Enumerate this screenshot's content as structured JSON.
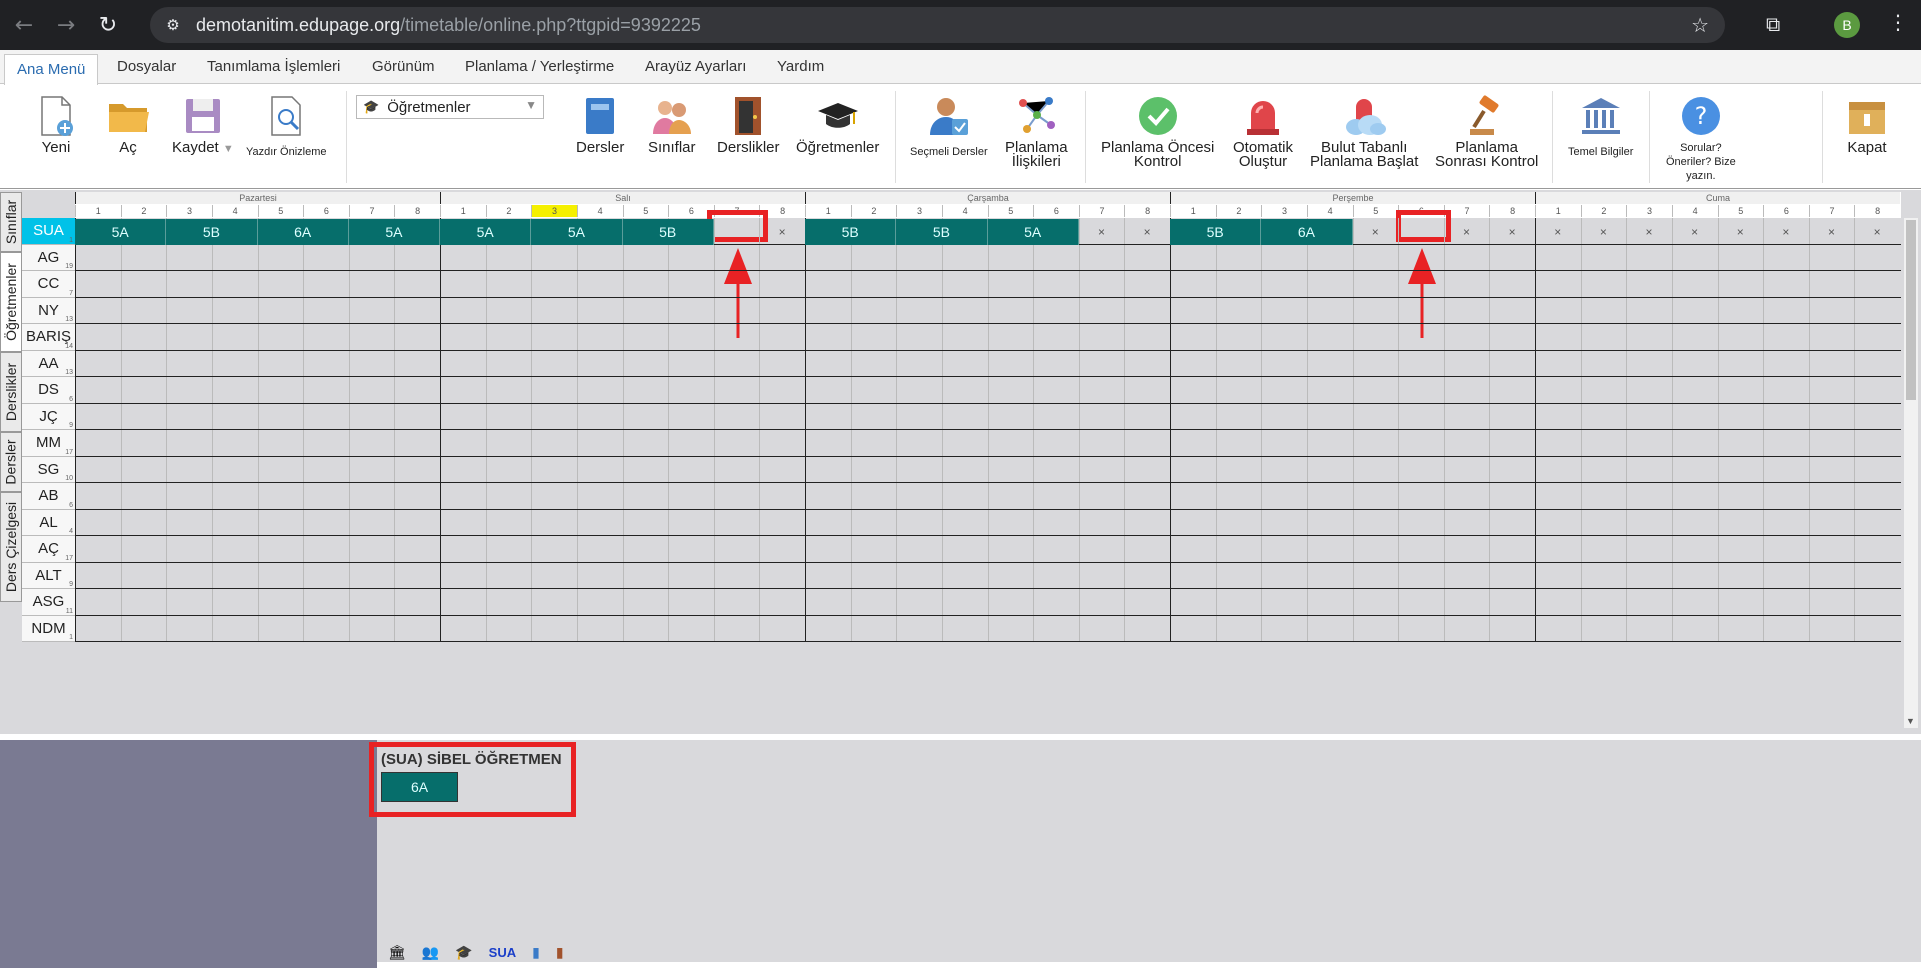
{
  "browser": {
    "url_host": "demotanitim.edupage.org",
    "url_path": "/timetable/online.php?ttgpid=9392225",
    "avatar_letter": "B"
  },
  "menu": [
    "Ana Menü",
    "Dosyalar",
    "Tanımlama İşlemleri",
    "Görünüm",
    "Planlama / Yerleştirme",
    "Arayüz Ayarları",
    "Yardım"
  ],
  "toolbar": {
    "new": "Yeni",
    "open": "Aç",
    "save": "Kaydet",
    "print_preview": "Yazdır Önizleme",
    "view_select": "Öğretmenler",
    "subjects": "Dersler",
    "classes": "Sınıflar",
    "classrooms": "Derslikler",
    "teachers": "Öğretmenler",
    "elective_1": "Seçmeli Dersler",
    "relations_1": "Planlama",
    "relations_2": "İlişkileri",
    "precheck_1": "Planlama Öncesi",
    "precheck_2": "Kontrol",
    "auto_1": "Otomatik",
    "auto_2": "Oluştur",
    "cloud_1": "Bulut Tabanlı",
    "cloud_2": "Planlama Başlat",
    "postcheck_1": "Planlama",
    "postcheck_2": "Sonrası Kontrol",
    "basic_info": "Temel Bilgiler",
    "feedback_1": "Sorular?",
    "feedback_2": "Öneriler? Bize",
    "feedback_3": "yazın.",
    "close": "Kapat"
  },
  "side_tabs": [
    "Sınıflar",
    "Öğretmenler",
    "Derslikler",
    "Dersler",
    "Ders Çizelgesi"
  ],
  "days": [
    "Pazartesi",
    "Salı",
    "Çarşamba",
    "Perşembe",
    "Cuma"
  ],
  "periods": [
    "1",
    "2",
    "3",
    "4",
    "5",
    "6",
    "7",
    "8"
  ],
  "highlight": {
    "day": 1,
    "period": 3
  },
  "teachers": [
    {
      "code": "SUA",
      "count": "1"
    },
    {
      "code": "AG",
      "count": "19"
    },
    {
      "code": "CC",
      "count": "7"
    },
    {
      "code": "NY",
      "count": "13"
    },
    {
      "code": "BARIŞ",
      "count": "14"
    },
    {
      "code": "AA",
      "count": "13"
    },
    {
      "code": "DS",
      "count": "6"
    },
    {
      "code": "JÇ",
      "count": "9"
    },
    {
      "code": "MM",
      "count": "17"
    },
    {
      "code": "SG",
      "count": "10"
    },
    {
      "code": "AB",
      "count": "6"
    },
    {
      "code": "AL",
      "count": "4"
    },
    {
      "code": "AÇ",
      "count": "17"
    },
    {
      "code": "ALT",
      "count": "9"
    },
    {
      "code": "ASG",
      "count": "11"
    },
    {
      "code": "NDM",
      "count": "1"
    }
  ],
  "sua_row": [
    [
      "5A",
      "5A",
      "5B",
      "5B",
      "6A",
      "6A",
      "5A",
      "5A"
    ],
    [
      "5A",
      "5A",
      "5A",
      "5A",
      "5B",
      "5B",
      "",
      "×"
    ],
    [
      "5B",
      "5B",
      "5B",
      "5B",
      "5A",
      "5A",
      "×",
      "×"
    ],
    [
      "5B",
      "5B",
      "6A",
      "6A",
      "×",
      "",
      "×",
      "×"
    ],
    [
      "×",
      "×",
      "×",
      "×",
      "×",
      "×",
      "×",
      "×"
    ]
  ],
  "bottom": {
    "title": "(SUA) SİBEL ÖĞRETMEN",
    "card": "6A",
    "teacher_code": "SUA"
  },
  "colors": {
    "lesson": "#066e6b",
    "selected_row": "#00c2e8",
    "annotation": "#e82224",
    "highlight_period": "#f5f000"
  }
}
